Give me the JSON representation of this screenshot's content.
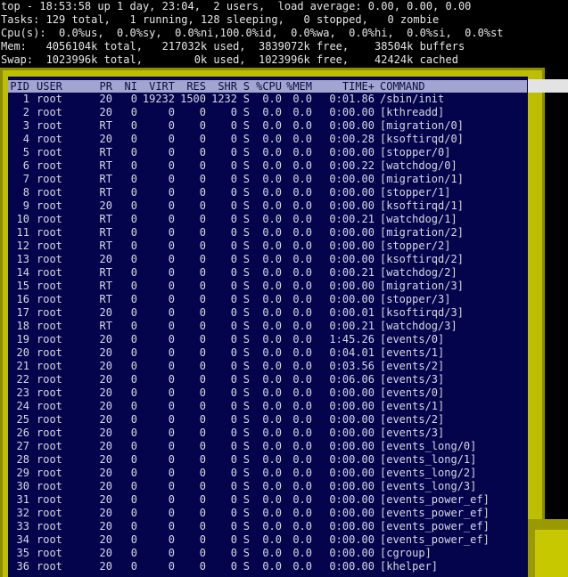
{
  "summary": [
    "top - 18:53:58 up 1 day, 23:04,  2 users,  load average: 0.00, 0.00, 0.00",
    "Tasks: 129 total,   1 running, 128 sleeping,   0 stopped,   0 zombie",
    "Cpu(s):  0.0%us,  0.0%sy,  0.0%ni,100.0%id,  0.0%wa,  0.0%hi,  0.0%si,  0.0%st",
    "Mem:   4056104k total,   217032k used,  3839072k free,    38504k buffers",
    "Swap:  1023996k total,        0k used,  1023996k free,    42424k cached"
  ],
  "columns": {
    "pid": "PID",
    "user": "USER",
    "pr": "PR",
    "ni": "NI",
    "virt": "VIRT",
    "res": "RES",
    "shr": "SHR",
    "s": "S",
    "cpu": "%CPU",
    "mem": "%MEM",
    "time": "TIME+",
    "command": "COMMAND"
  },
  "colors": {
    "panel": "#03044b",
    "header": "#a3a5d1",
    "highlight": "#bebe00"
  },
  "processes": [
    {
      "pid": "1",
      "user": "root",
      "pr": "20",
      "ni": "0",
      "virt": "19232",
      "res": "1500",
      "shr": "1232",
      "s": "S",
      "cpu": "0.0",
      "mem": "0.0",
      "time": "0:01.86",
      "command": "/sbin/init"
    },
    {
      "pid": "2",
      "user": "root",
      "pr": "20",
      "ni": "0",
      "virt": "0",
      "res": "0",
      "shr": "0",
      "s": "S",
      "cpu": "0.0",
      "mem": "0.0",
      "time": "0:00.00",
      "command": "[kthreadd]"
    },
    {
      "pid": "3",
      "user": "root",
      "pr": "RT",
      "ni": "0",
      "virt": "0",
      "res": "0",
      "shr": "0",
      "s": "S",
      "cpu": "0.0",
      "mem": "0.0",
      "time": "0:00.00",
      "command": "[migration/0]"
    },
    {
      "pid": "4",
      "user": "root",
      "pr": "20",
      "ni": "0",
      "virt": "0",
      "res": "0",
      "shr": "0",
      "s": "S",
      "cpu": "0.0",
      "mem": "0.0",
      "time": "0:00.28",
      "command": "[ksoftirqd/0]"
    },
    {
      "pid": "5",
      "user": "root",
      "pr": "RT",
      "ni": "0",
      "virt": "0",
      "res": "0",
      "shr": "0",
      "s": "S",
      "cpu": "0.0",
      "mem": "0.0",
      "time": "0:00.00",
      "command": "[stopper/0]"
    },
    {
      "pid": "6",
      "user": "root",
      "pr": "RT",
      "ni": "0",
      "virt": "0",
      "res": "0",
      "shr": "0",
      "s": "S",
      "cpu": "0.0",
      "mem": "0.0",
      "time": "0:00.22",
      "command": "[watchdog/0]"
    },
    {
      "pid": "7",
      "user": "root",
      "pr": "RT",
      "ni": "0",
      "virt": "0",
      "res": "0",
      "shr": "0",
      "s": "S",
      "cpu": "0.0",
      "mem": "0.0",
      "time": "0:00.00",
      "command": "[migration/1]"
    },
    {
      "pid": "8",
      "user": "root",
      "pr": "RT",
      "ni": "0",
      "virt": "0",
      "res": "0",
      "shr": "0",
      "s": "S",
      "cpu": "0.0",
      "mem": "0.0",
      "time": "0:00.00",
      "command": "[stopper/1]"
    },
    {
      "pid": "9",
      "user": "root",
      "pr": "20",
      "ni": "0",
      "virt": "0",
      "res": "0",
      "shr": "0",
      "s": "S",
      "cpu": "0.0",
      "mem": "0.0",
      "time": "0:00.00",
      "command": "[ksoftirqd/1]"
    },
    {
      "pid": "10",
      "user": "root",
      "pr": "RT",
      "ni": "0",
      "virt": "0",
      "res": "0",
      "shr": "0",
      "s": "S",
      "cpu": "0.0",
      "mem": "0.0",
      "time": "0:00.21",
      "command": "[watchdog/1]"
    },
    {
      "pid": "11",
      "user": "root",
      "pr": "RT",
      "ni": "0",
      "virt": "0",
      "res": "0",
      "shr": "0",
      "s": "S",
      "cpu": "0.0",
      "mem": "0.0",
      "time": "0:00.00",
      "command": "[migration/2]"
    },
    {
      "pid": "12",
      "user": "root",
      "pr": "RT",
      "ni": "0",
      "virt": "0",
      "res": "0",
      "shr": "0",
      "s": "S",
      "cpu": "0.0",
      "mem": "0.0",
      "time": "0:00.00",
      "command": "[stopper/2]"
    },
    {
      "pid": "13",
      "user": "root",
      "pr": "20",
      "ni": "0",
      "virt": "0",
      "res": "0",
      "shr": "0",
      "s": "S",
      "cpu": "0.0",
      "mem": "0.0",
      "time": "0:00.00",
      "command": "[ksoftirqd/2]"
    },
    {
      "pid": "14",
      "user": "root",
      "pr": "RT",
      "ni": "0",
      "virt": "0",
      "res": "0",
      "shr": "0",
      "s": "S",
      "cpu": "0.0",
      "mem": "0.0",
      "time": "0:00.21",
      "command": "[watchdog/2]"
    },
    {
      "pid": "15",
      "user": "root",
      "pr": "RT",
      "ni": "0",
      "virt": "0",
      "res": "0",
      "shr": "0",
      "s": "S",
      "cpu": "0.0",
      "mem": "0.0",
      "time": "0:00.00",
      "command": "[migration/3]"
    },
    {
      "pid": "16",
      "user": "root",
      "pr": "RT",
      "ni": "0",
      "virt": "0",
      "res": "0",
      "shr": "0",
      "s": "S",
      "cpu": "0.0",
      "mem": "0.0",
      "time": "0:00.00",
      "command": "[stopper/3]"
    },
    {
      "pid": "17",
      "user": "root",
      "pr": "20",
      "ni": "0",
      "virt": "0",
      "res": "0",
      "shr": "0",
      "s": "S",
      "cpu": "0.0",
      "mem": "0.0",
      "time": "0:00.01",
      "command": "[ksoftirqd/3]"
    },
    {
      "pid": "18",
      "user": "root",
      "pr": "RT",
      "ni": "0",
      "virt": "0",
      "res": "0",
      "shr": "0",
      "s": "S",
      "cpu": "0.0",
      "mem": "0.0",
      "time": "0:00.21",
      "command": "[watchdog/3]"
    },
    {
      "pid": "19",
      "user": "root",
      "pr": "20",
      "ni": "0",
      "virt": "0",
      "res": "0",
      "shr": "0",
      "s": "S",
      "cpu": "0.0",
      "mem": "0.0",
      "time": "1:45.26",
      "command": "[events/0]"
    },
    {
      "pid": "20",
      "user": "root",
      "pr": "20",
      "ni": "0",
      "virt": "0",
      "res": "0",
      "shr": "0",
      "s": "S",
      "cpu": "0.0",
      "mem": "0.0",
      "time": "0:04.01",
      "command": "[events/1]"
    },
    {
      "pid": "21",
      "user": "root",
      "pr": "20",
      "ni": "0",
      "virt": "0",
      "res": "0",
      "shr": "0",
      "s": "S",
      "cpu": "0.0",
      "mem": "0.0",
      "time": "0:03.56",
      "command": "[events/2]"
    },
    {
      "pid": "22",
      "user": "root",
      "pr": "20",
      "ni": "0",
      "virt": "0",
      "res": "0",
      "shr": "0",
      "s": "S",
      "cpu": "0.0",
      "mem": "0.0",
      "time": "0:06.06",
      "command": "[events/3]"
    },
    {
      "pid": "23",
      "user": "root",
      "pr": "20",
      "ni": "0",
      "virt": "0",
      "res": "0",
      "shr": "0",
      "s": "S",
      "cpu": "0.0",
      "mem": "0.0",
      "time": "0:00.00",
      "command": "[events/0]"
    },
    {
      "pid": "24",
      "user": "root",
      "pr": "20",
      "ni": "0",
      "virt": "0",
      "res": "0",
      "shr": "0",
      "s": "S",
      "cpu": "0.0",
      "mem": "0.0",
      "time": "0:00.00",
      "command": "[events/1]"
    },
    {
      "pid": "25",
      "user": "root",
      "pr": "20",
      "ni": "0",
      "virt": "0",
      "res": "0",
      "shr": "0",
      "s": "S",
      "cpu": "0.0",
      "mem": "0.0",
      "time": "0:00.00",
      "command": "[events/2]"
    },
    {
      "pid": "26",
      "user": "root",
      "pr": "20",
      "ni": "0",
      "virt": "0",
      "res": "0",
      "shr": "0",
      "s": "S",
      "cpu": "0.0",
      "mem": "0.0",
      "time": "0:00.00",
      "command": "[events/3]"
    },
    {
      "pid": "27",
      "user": "root",
      "pr": "20",
      "ni": "0",
      "virt": "0",
      "res": "0",
      "shr": "0",
      "s": "S",
      "cpu": "0.0",
      "mem": "0.0",
      "time": "0:00.00",
      "command": "[events_long/0]"
    },
    {
      "pid": "28",
      "user": "root",
      "pr": "20",
      "ni": "0",
      "virt": "0",
      "res": "0",
      "shr": "0",
      "s": "S",
      "cpu": "0.0",
      "mem": "0.0",
      "time": "0:00.00",
      "command": "[events_long/1]"
    },
    {
      "pid": "29",
      "user": "root",
      "pr": "20",
      "ni": "0",
      "virt": "0",
      "res": "0",
      "shr": "0",
      "s": "S",
      "cpu": "0.0",
      "mem": "0.0",
      "time": "0:00.00",
      "command": "[events_long/2]"
    },
    {
      "pid": "30",
      "user": "root",
      "pr": "20",
      "ni": "0",
      "virt": "0",
      "res": "0",
      "shr": "0",
      "s": "S",
      "cpu": "0.0",
      "mem": "0.0",
      "time": "0:00.00",
      "command": "[events_long/3]"
    },
    {
      "pid": "31",
      "user": "root",
      "pr": "20",
      "ni": "0",
      "virt": "0",
      "res": "0",
      "shr": "0",
      "s": "S",
      "cpu": "0.0",
      "mem": "0.0",
      "time": "0:00.00",
      "command": "[events_power_ef]"
    },
    {
      "pid": "32",
      "user": "root",
      "pr": "20",
      "ni": "0",
      "virt": "0",
      "res": "0",
      "shr": "0",
      "s": "S",
      "cpu": "0.0",
      "mem": "0.0",
      "time": "0:00.00",
      "command": "[events_power_ef]"
    },
    {
      "pid": "33",
      "user": "root",
      "pr": "20",
      "ni": "0",
      "virt": "0",
      "res": "0",
      "shr": "0",
      "s": "S",
      "cpu": "0.0",
      "mem": "0.0",
      "time": "0:00.00",
      "command": "[events_power_ef]"
    },
    {
      "pid": "34",
      "user": "root",
      "pr": "20",
      "ni": "0",
      "virt": "0",
      "res": "0",
      "shr": "0",
      "s": "S",
      "cpu": "0.0",
      "mem": "0.0",
      "time": "0:00.00",
      "command": "[events_power_ef]"
    },
    {
      "pid": "35",
      "user": "root",
      "pr": "20",
      "ni": "0",
      "virt": "0",
      "res": "0",
      "shr": "0",
      "s": "S",
      "cpu": "0.0",
      "mem": "0.0",
      "time": "0:00.00",
      "command": "[cgroup]"
    },
    {
      "pid": "36",
      "user": "root",
      "pr": "20",
      "ni": "0",
      "virt": "0",
      "res": "0",
      "shr": "0",
      "s": "S",
      "cpu": "0.0",
      "mem": "0.0",
      "time": "0:00.00",
      "command": "[khelper]"
    }
  ]
}
